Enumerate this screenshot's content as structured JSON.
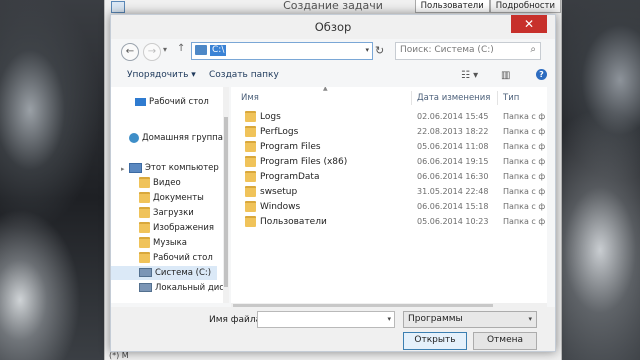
{
  "background_window": {
    "title": "Создание задачи",
    "tabs": [
      "Пользователи",
      "Подробности"
    ],
    "bottom_text": "(*)  M"
  },
  "dialog": {
    "title": "Обзор",
    "close_glyph": "✕",
    "address_path": "C:\\",
    "search_placeholder": "Поиск: Система (C:)",
    "toolbar": {
      "organize": "Упорядочить ▾",
      "new_folder": "Создать папку"
    },
    "nav_items": [
      {
        "label": "Рабочий стол",
        "icon": "desktop-icon"
      },
      {
        "label": "Домашняя группа",
        "icon": "homegroup-icon"
      },
      {
        "label": "Этот компьютер",
        "icon": "computer-icon"
      },
      {
        "label": "Видео",
        "icon": "folder-icon"
      },
      {
        "label": "Документы",
        "icon": "folder-icon"
      },
      {
        "label": "Загрузки",
        "icon": "folder-icon"
      },
      {
        "label": "Изображения",
        "icon": "folder-icon"
      },
      {
        "label": "Музыка",
        "icon": "folder-icon"
      },
      {
        "label": "Рабочий стол",
        "icon": "folder-icon"
      },
      {
        "label": "Система (C:)",
        "icon": "drive-icon",
        "selected": true
      },
      {
        "label": "Локальный диск",
        "icon": "drive-icon"
      }
    ],
    "columns": {
      "name": "Имя",
      "date": "Дата изменения",
      "type": "Тип"
    },
    "files": [
      {
        "name": "Logs",
        "date": "02.06.2014 15:45",
        "type": "Папка с ф"
      },
      {
        "name": "PerfLogs",
        "date": "22.08.2013 18:22",
        "type": "Папка с ф"
      },
      {
        "name": "Program Files",
        "date": "05.06.2014 11:08",
        "type": "Папка с ф"
      },
      {
        "name": "Program Files (x86)",
        "date": "06.06.2014 19:15",
        "type": "Папка с ф"
      },
      {
        "name": "ProgramData",
        "date": "06.06.2014 16:30",
        "type": "Папка с ф"
      },
      {
        "name": "swsetup",
        "date": "31.05.2014 22:48",
        "type": "Папка с ф"
      },
      {
        "name": "Windows",
        "date": "06.06.2014 15:18",
        "type": "Папка с ф"
      },
      {
        "name": "Пользователи",
        "date": "05.06.2014 10:23",
        "type": "Папка с ф"
      }
    ],
    "filename_label": "Имя файла:",
    "filename_value": "",
    "filetype_value": "Программы",
    "open_button": "Открыть",
    "cancel_button": "Отмена"
  }
}
